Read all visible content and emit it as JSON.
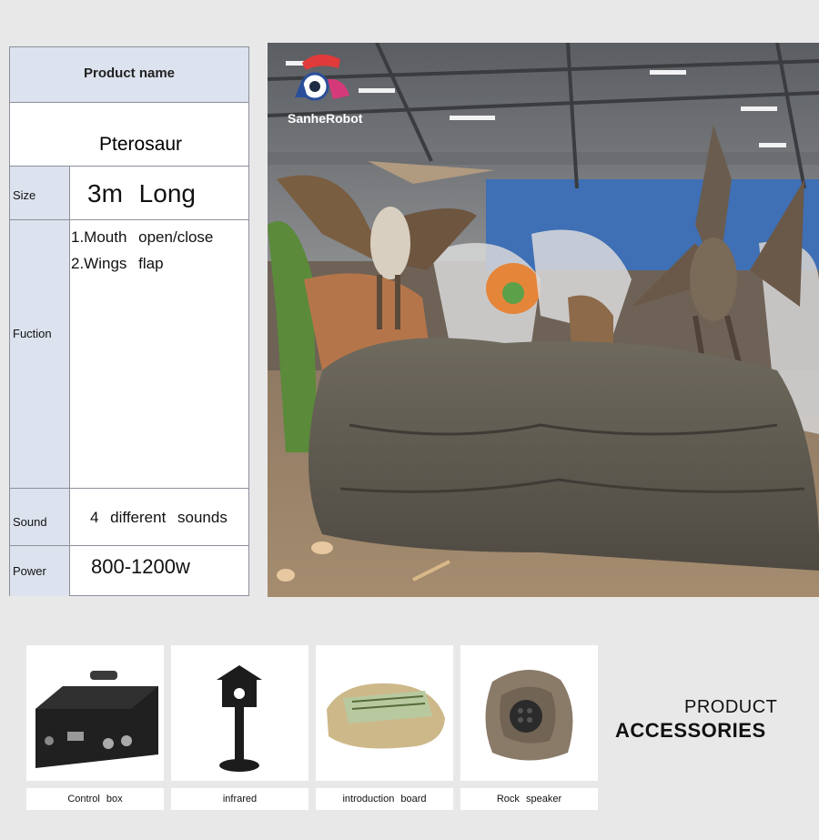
{
  "spec": {
    "header": "Product  name",
    "name_value": "Pterosaur",
    "size_label": "Size",
    "size_value": "3m Long",
    "function_label": "Fuction",
    "functions": [
      "1.Mouth open/close",
      "2.Wings flap"
    ],
    "sound_label": "Sound",
    "sound_value": "4 different sounds",
    "power_label": "Power",
    "power_value": "800-1200w"
  },
  "photo": {
    "logo_text": "SanheRobot"
  },
  "accessories": {
    "title_line1": "PRODUCT",
    "title_line2": "ACCESSORIES",
    "items": [
      {
        "label": "Control box"
      },
      {
        "label": "infrared"
      },
      {
        "label": "introduction board"
      },
      {
        "label": "Rock speaker"
      }
    ]
  },
  "colors": {
    "page_bg": "#e8e8e8",
    "label_cell_bg": "#dce3ee",
    "border": "#8b9099",
    "logo_red": "#e03a3a",
    "logo_pink": "#d43a7a"
  }
}
